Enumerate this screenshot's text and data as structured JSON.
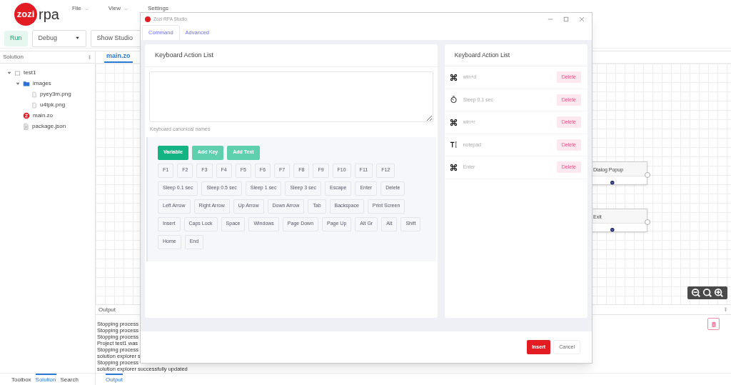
{
  "app": {
    "logo": {
      "mark": "zozi",
      "text": "rpa"
    },
    "menu": [
      "File",
      "View",
      "Settings"
    ]
  },
  "toolbar": {
    "run": "Run",
    "mode": "Debug",
    "show": "Show Studio"
  },
  "solution": {
    "title": "Solution",
    "tree": [
      {
        "label": "test1",
        "kind": "project",
        "expanded": true,
        "children": [
          {
            "label": "images",
            "kind": "folder",
            "expanded": true,
            "children": [
              {
                "label": "pyey3m.png",
                "kind": "file"
              },
              {
                "label": "u4tpk.png",
                "kind": "file"
              }
            ]
          },
          {
            "label": "main.zo",
            "kind": "zo"
          },
          {
            "label": "package.json",
            "kind": "json"
          }
        ]
      }
    ],
    "tabs": [
      {
        "label": "Toolbox",
        "selected": false
      },
      {
        "label": "Solution",
        "selected": true
      },
      {
        "label": "Search",
        "selected": false
      }
    ]
  },
  "editor": {
    "tabs": [
      {
        "label": "main.zo",
        "selected": true
      }
    ],
    "nodes": [
      {
        "label": "Dialog Popup"
      },
      {
        "label": "Exit"
      }
    ]
  },
  "output": {
    "title": "Output",
    "lines": [
      "Stopping process",
      "Stopping process",
      "Stopping process",
      "Project test1 was",
      "Stopping process",
      "solution explorer s",
      "Stopping process",
      "solution explorer successfully updated"
    ],
    "tabs": [
      {
        "label": "Output",
        "selected": true
      }
    ]
  },
  "dialog": {
    "title": "Zozi RPA Studio",
    "tabs": [
      {
        "label": "Command",
        "selected": true
      },
      {
        "label": "Advanced",
        "selected": false
      }
    ],
    "editor": {
      "title": "Keyboard Action List",
      "hint": "Keyboard canonical names",
      "modes": [
        {
          "label": "Variable",
          "selected": true
        },
        {
          "label": "Add Key",
          "selected": false
        },
        {
          "label": "Add Text",
          "selected": false
        }
      ],
      "key_rows": [
        [
          "F1",
          "F2",
          "F3",
          "F4",
          "F5",
          "F6",
          "F7",
          "F8",
          "F9",
          "F10",
          "F11",
          "F12"
        ],
        [
          "Sleep 0.1 sec",
          "Sleep 0.5 sec",
          "Sleep 1 sec",
          "Sleep 3 sec",
          "Escape",
          "Enter",
          "Delete"
        ],
        [
          "Left Arrow",
          "Right Arrow",
          "Up Arrow",
          "Down Arrow",
          "Tab",
          "Backspace",
          "Print Screen"
        ],
        [
          "Insert",
          "Caps Lock",
          "Space",
          "Windows",
          "Page Down",
          "Page Up",
          "Alt Gr",
          "Alt",
          "Shift"
        ],
        [
          "Home",
          "End"
        ]
      ]
    },
    "actions": {
      "title": "Keyboard Action List",
      "items": [
        {
          "kind": "key",
          "label": "win+d",
          "button": "Delete"
        },
        {
          "kind": "sleep",
          "label": "Sleep 0.1 sec",
          "button": "Delete"
        },
        {
          "kind": "key",
          "label": "win+r",
          "button": "Delete"
        },
        {
          "kind": "text",
          "label": "notepad",
          "button": "Delete"
        },
        {
          "kind": "key",
          "label": "Enter",
          "button": "Delete"
        }
      ]
    },
    "buttons": {
      "insert": "Insert",
      "cancel": "Cancel"
    }
  }
}
